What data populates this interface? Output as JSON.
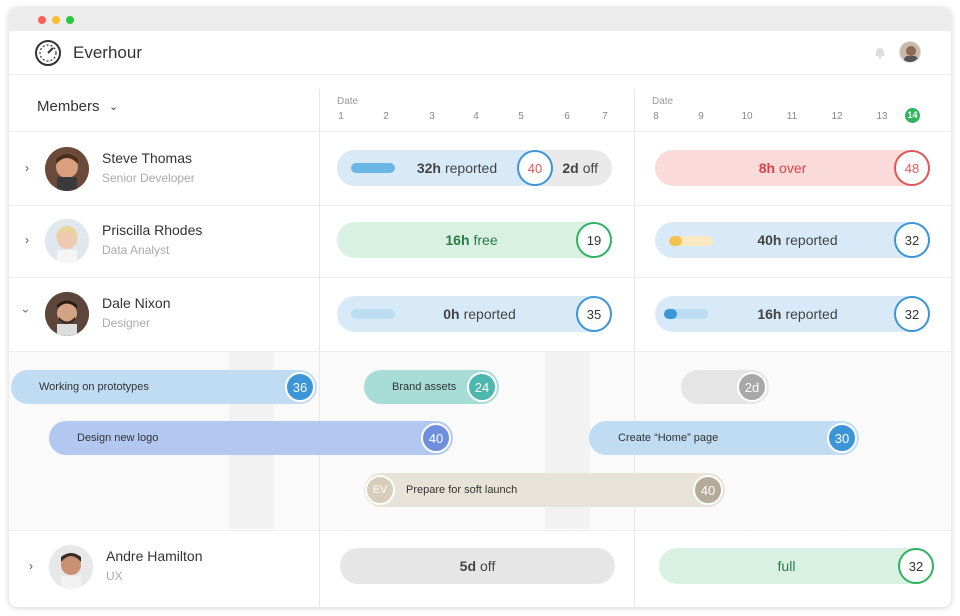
{
  "window": {
    "controls": [
      "#ff5f57",
      "#ffbd2e",
      "#28c840"
    ]
  },
  "app": {
    "name": "Everhour"
  },
  "header": {
    "members_label": "Members",
    "date_label_1": "Date",
    "date_label_2": "Date"
  },
  "days_week1": [
    "1",
    "2",
    "3",
    "4",
    "5",
    "6",
    "7"
  ],
  "days_week2": [
    "8",
    "9",
    "10",
    "11",
    "12",
    "13"
  ],
  "today": "14",
  "members": [
    {
      "name": "Steve Thomas",
      "role": "Senior Developer"
    },
    {
      "name": "Priscilla Rhodes",
      "role": "Data Analyst"
    },
    {
      "name": "Dale Nixon",
      "role": "Designer"
    },
    {
      "name": "Andre Hamilton",
      "role": "UX"
    }
  ],
  "cells": {
    "steve_w1_value": "32h",
    "steve_w1_text": "reported",
    "steve_w1_circle": "40",
    "steve_w1_off_value": "2d",
    "steve_w1_off_text": "off",
    "steve_w2_value": "8h",
    "steve_w2_text": "over",
    "steve_w2_circle": "48",
    "pris_w1_value": "16h",
    "pris_w1_text": "free",
    "pris_w1_circle": "19",
    "pris_w2_value": "40h",
    "pris_w2_text": "reported",
    "pris_w2_circle": "32",
    "dale_w1_value": "0h",
    "dale_w1_text": "reported",
    "dale_w1_circle": "35",
    "dale_w2_value": "16h",
    "dale_w2_text": "reported",
    "dale_w2_circle": "32",
    "andre_w1_value": "5d",
    "andre_w1_text": "off",
    "andre_w2_text": "full",
    "andre_w2_circle": "32"
  },
  "tasks": [
    {
      "label": "Working on prototypes",
      "hours": "36"
    },
    {
      "label": "Brand assets",
      "hours": "24"
    },
    {
      "label": "",
      "hours": "2d"
    },
    {
      "label": "Design new logo",
      "hours": "40"
    },
    {
      "label": "Create “Home” page",
      "hours": "30"
    },
    {
      "label": "Prepare for soft launch",
      "hours": "40",
      "initials": "EV"
    }
  ],
  "colors": {
    "blue_pill": "#d8eaf7",
    "blue_circle": "#3b95d6",
    "red_pill": "#fbdada",
    "red_circle": "#e0575b",
    "green_pill": "#d9f1e2",
    "green_circle": "#2fb35f",
    "grey_pill": "#e6e6e6"
  }
}
